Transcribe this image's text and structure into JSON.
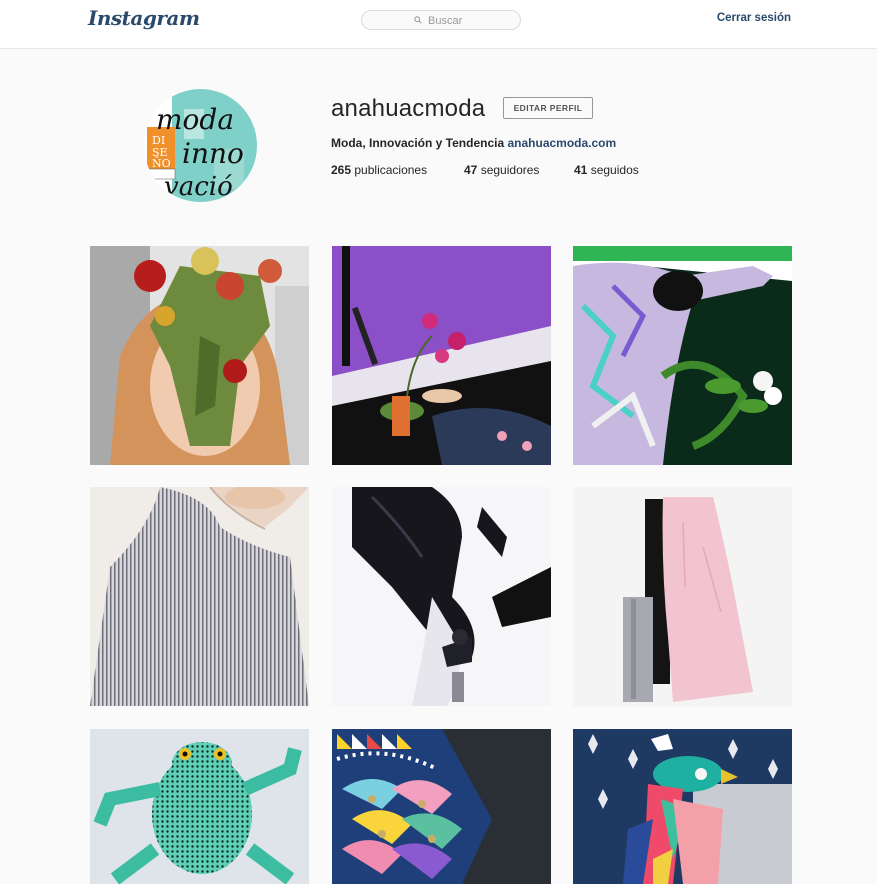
{
  "header": {
    "logo_text": "Instagram",
    "search_placeholder": "Buscar",
    "logout_label": "Cerrar sesión"
  },
  "profile": {
    "username": "anahuacmoda",
    "edit_label": "EDITAR PERFIL",
    "bio_text": "Moda, Innovación y Tendencia",
    "bio_link": "anahuacmoda.com",
    "avatar_text": {
      "line1": "moda",
      "line2": "DI",
      "line3": "SE",
      "line4": "ÑO",
      "line5": "inno",
      "line6": "vació"
    },
    "stats": {
      "posts_count": "265",
      "posts_label": "publicaciones",
      "followers_count": "47",
      "followers_label": "seguidores",
      "following_count": "41",
      "following_label": "seguidos"
    }
  },
  "colors": {
    "accent": "#2b4a6b",
    "background": "#fafafa",
    "border": "#e6e6e6"
  },
  "posts": [
    {
      "subject": "floral-collage-portrait"
    },
    {
      "subject": "orchid-purple-set"
    },
    {
      "subject": "printed-jacket-lilies"
    },
    {
      "subject": "striped-blouse"
    },
    {
      "subject": "black-satin-outfit"
    },
    {
      "subject": "pink-coat-flatlay"
    },
    {
      "subject": "beaded-frog"
    },
    {
      "subject": "geometric-bird-print"
    },
    {
      "subject": "geometric-parrot-print"
    }
  ]
}
